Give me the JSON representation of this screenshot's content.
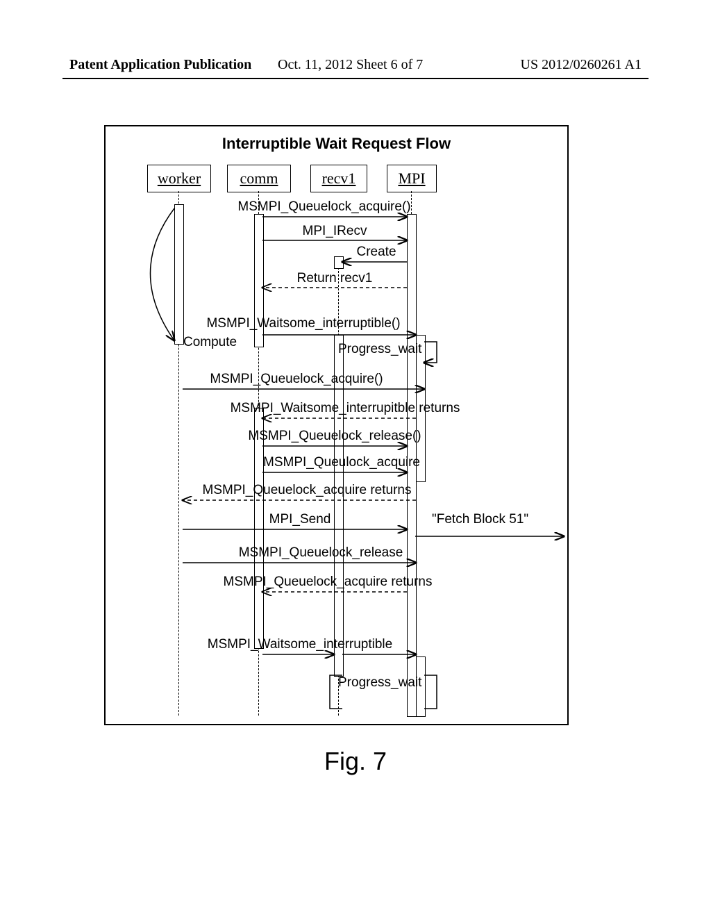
{
  "header": {
    "left": "Patent Application Publication",
    "center": "Oct. 11, 2012 Sheet 6 of 7",
    "right": "US 2012/0260261 A1"
  },
  "diagram": {
    "title": "Interruptible Wait Request Flow",
    "lifelines": {
      "worker": "worker",
      "comm": "comm",
      "recv1": "recv1",
      "mpi": "MPI"
    },
    "messages": {
      "m1": "MSMPI_Queuelock_acquire()",
      "m2": "MPI_IRecv",
      "m3": "Create",
      "m4": "Return recv1",
      "m5": "MSMPI_Waitsome_interruptible()",
      "m6": "Compute",
      "m7": "Progress_wait",
      "m8": "MSMPI_Queuelock_acquire()",
      "m9": "MSMPI_Waitsome_interrupitble returns",
      "m10": "MSMPI_Queuelock_release()",
      "m11": "MSMPI_Queulock_acquire",
      "m12": "MSMPI_Queuelock_acquire returns",
      "m13": "MPI_Send",
      "m14": "\"Fetch Block 51\"",
      "m15": "MSMPI_Queuelock_release",
      "m16": "MSMPI_Queuelock_acquire returns",
      "m17": "MSMPI_Waitsome_interruptible",
      "m18": "Progress_wait"
    }
  },
  "figure_label": "Fig. 7",
  "chart_data": {
    "type": "sequence-diagram",
    "title": "Interruptible Wait Request Flow",
    "participants": [
      "worker",
      "comm",
      "recv1",
      "MPI"
    ],
    "events": [
      {
        "from": "comm",
        "to": "MPI",
        "kind": "call",
        "label": "MSMPI_Queuelock_acquire()"
      },
      {
        "from": "comm",
        "to": "MPI",
        "kind": "call",
        "label": "MPI_IRecv"
      },
      {
        "from": "MPI",
        "to": "recv1",
        "kind": "create",
        "label": "Create"
      },
      {
        "from": "MPI",
        "to": "comm",
        "kind": "return",
        "label": "Return recv1"
      },
      {
        "from": "comm",
        "to": "MPI",
        "kind": "call",
        "label": "MSMPI_Waitsome_interruptible()"
      },
      {
        "from": "worker",
        "to": "worker",
        "kind": "self",
        "label": "Compute"
      },
      {
        "from": "MPI",
        "to": "MPI",
        "kind": "self",
        "label": "Progress_wait"
      },
      {
        "from": "worker",
        "to": "MPI",
        "kind": "call",
        "label": "MSMPI_Queuelock_acquire()"
      },
      {
        "from": "MPI",
        "to": "comm",
        "kind": "return",
        "label": "MSMPI_Waitsome_interrupitble returns"
      },
      {
        "from": "comm",
        "to": "MPI",
        "kind": "call",
        "label": "MSMPI_Queuelock_release()"
      },
      {
        "from": "comm",
        "to": "MPI",
        "kind": "call",
        "label": "MSMPI_Queulock_acquire"
      },
      {
        "from": "MPI",
        "to": "worker",
        "kind": "return",
        "label": "MSMPI_Queuelock_acquire returns"
      },
      {
        "from": "worker",
        "to": "MPI",
        "kind": "call",
        "label": "MPI_Send"
      },
      {
        "from": "MPI",
        "to": "external",
        "kind": "call",
        "label": "\"Fetch Block 51\""
      },
      {
        "from": "worker",
        "to": "MPI",
        "kind": "call",
        "label": "MSMPI_Queuelock_release"
      },
      {
        "from": "MPI",
        "to": "comm",
        "kind": "return",
        "label": "MSMPI_Queuelock_acquire returns"
      },
      {
        "from": "comm",
        "to": "MPI",
        "kind": "call",
        "label": "MSMPI_Waitsome_interruptible"
      },
      {
        "from": "MPI",
        "to": "MPI",
        "kind": "self",
        "label": "Progress_wait"
      }
    ]
  }
}
